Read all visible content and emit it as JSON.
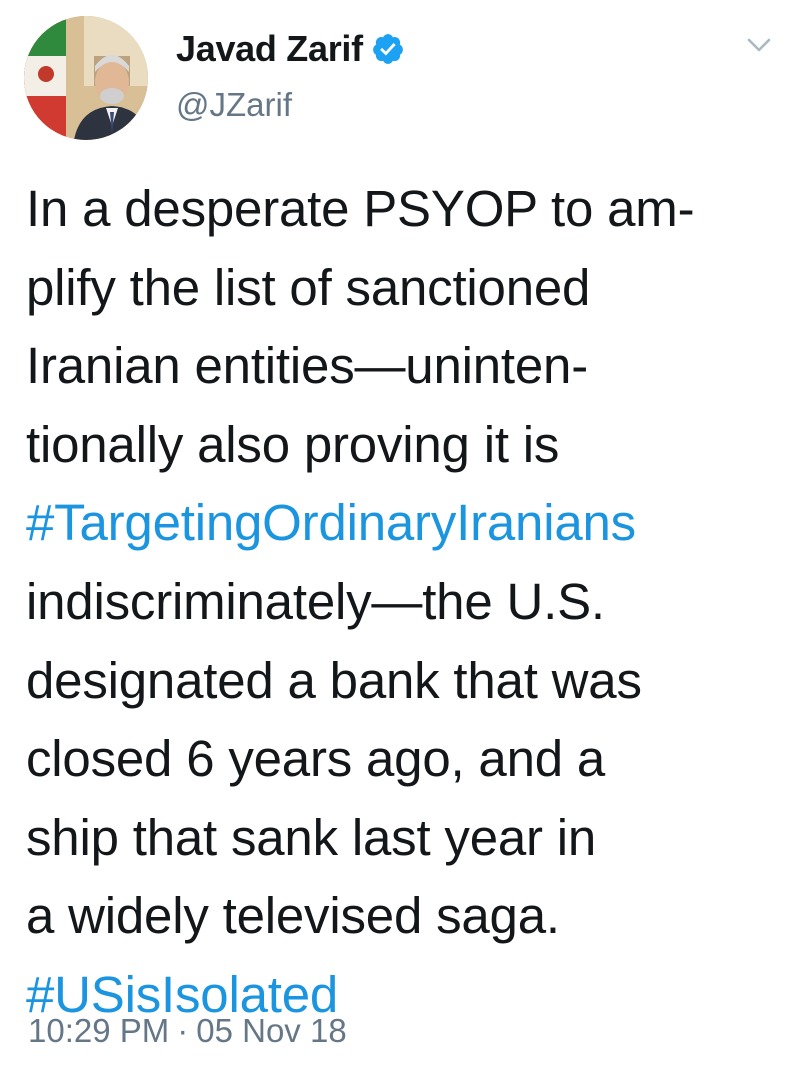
{
  "author": {
    "display_name": "Javad Zarif",
    "handle": "@JZarif",
    "verified": true,
    "avatar_icon": "profile-photo"
  },
  "tweet": {
    "lines": [
      {
        "text": "In a desperate PSYOP to am-",
        "hashtag": false
      },
      {
        "text": "plify the list of sanctioned",
        "hashtag": false
      },
      {
        "text": "Iranian entities—uninten-",
        "hashtag": false
      },
      {
        "text": "tionally also proving it is",
        "hashtag": false
      },
      {
        "text": "#TargetingOrdinaryIranians",
        "hashtag": true
      },
      {
        "text": "indiscriminately—the U.S.",
        "hashtag": false
      },
      {
        "text": "designated a bank that was",
        "hashtag": false
      },
      {
        "text": "closed 6 years ago, and a",
        "hashtag": false
      },
      {
        "text": "ship that sank last year in",
        "hashtag": false
      },
      {
        "text": "a widely televised saga.",
        "hashtag": false
      },
      {
        "text": "#USisIsolated",
        "hashtag": true
      }
    ]
  },
  "meta": {
    "time": "10:29 PM",
    "separator": "·",
    "date": "05 Nov 18"
  },
  "colors": {
    "text": "#14171a",
    "secondary": "#657786",
    "link": "#1b95e0",
    "verified": "#1da1f2"
  },
  "icons": {
    "menu": "chevron-down-icon",
    "verified": "verified-badge-icon"
  }
}
